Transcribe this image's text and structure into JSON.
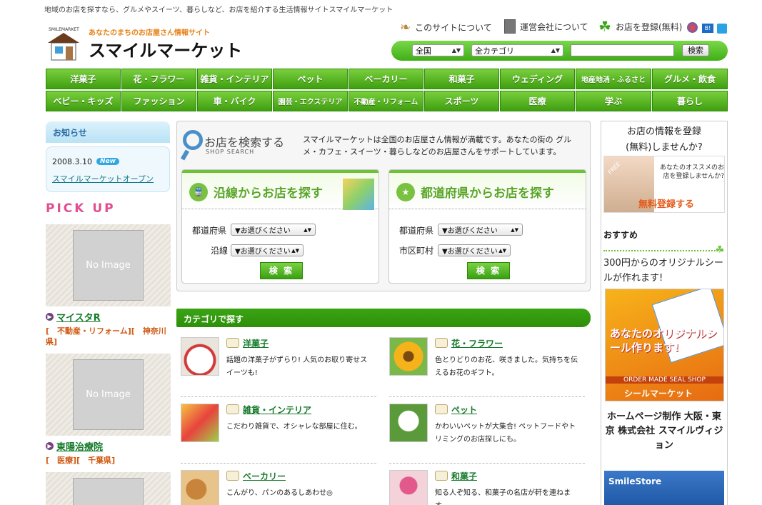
{
  "header": {
    "tagline": "地域のお店を探すなら、グルメやスイーツ、暮らしなど、お店を紹介する生活情報サイトスマイルマーケット",
    "logo_arc": "SMILEMARKET",
    "logo_sub": "あなたのまちのお店屋さん情報サイト",
    "logo_main": "スマイルマーケット",
    "links": [
      {
        "label": "このサイトについて",
        "icon": "bird-icon"
      },
      {
        "label": "運営会社について",
        "icon": "building-icon"
      },
      {
        "label": "お店を登録(無料)",
        "icon": "sprout-icon"
      }
    ],
    "search": {
      "area": "全国",
      "category": "全カテゴリ",
      "keyword": "",
      "button": "検索"
    }
  },
  "nav": {
    "row1": [
      "洋菓子",
      "花・フラワー",
      "雑貨・インテリア",
      "ペット",
      "ベーカリー",
      "和菓子",
      "ウェディング",
      "地産地消・ふるさと",
      "グルメ・飲食"
    ],
    "row2": [
      "ベビー・キッズ",
      "ファッション",
      "車・バイク",
      "園芸・エクステリア",
      "不動産・リフォーム",
      "スポーツ",
      "医療",
      "学ぶ",
      "暮らし"
    ]
  },
  "left": {
    "news_title": "お知らせ",
    "news": {
      "date": "2008.3.10",
      "badge": "New",
      "text": "スマイルマーケットオープン"
    },
    "pickup_label": "PICK UP",
    "no_image": "No Image",
    "picks": [
      {
        "name": "マイスタR",
        "cat": "[　不動産・リフォーム][　神奈川県]"
      },
      {
        "name": "東陽治療院",
        "cat": "[　医療][　千葉県]"
      }
    ]
  },
  "shop_search": {
    "title": "お店を検索する",
    "subtitle": "SHOP SEARCH",
    "desc": "スマイルマーケットは全国のお店屋さん情報が満載です。あなたの街の グルメ・カフェ・スイーツ・暮らしなどのお店屋さんをサポートしています。",
    "line_panel": {
      "title": "沿線からお店を探す",
      "pref_label": "都道府県",
      "pref_value": "▼お選びください",
      "line_label": "沿線",
      "line_value": "▼お選びください",
      "button": "検 索"
    },
    "pref_panel": {
      "title": "都道府県からお店を探す",
      "pref_label": "都道府県",
      "pref_value": "▼お選びください",
      "city_label": "市区町村",
      "city_value": "▼お選びください",
      "button": "検 索"
    }
  },
  "category": {
    "bar_title": "カテゴリで探す",
    "items": [
      {
        "title": "洋菓子",
        "desc": "話題の洋菓子がずらり! 人気のお取り寄せスイーツも!"
      },
      {
        "title": "花・フラワー",
        "desc": "色とりどりのお花、咲きました。気持ちを伝えるお花のギフト。"
      },
      {
        "title": "雑貨・インテリア",
        "desc": "こだわり雑貨で、オシャレな部屋に住む。"
      },
      {
        "title": "ペット",
        "desc": "かわいいペットが大集合! ペットフードやトリミングのお店探しにも。"
      },
      {
        "title": "ベーカリー",
        "desc": "こんがり、パンのあるしあわせ◎"
      },
      {
        "title": "和菓子",
        "desc": "知る人ぞ知る、和菓子の名店が軒を連ねます。"
      }
    ]
  },
  "right": {
    "register_text": "お店の情報を登録(無料)しませんか?",
    "free_label": "FREE",
    "free_text": "あなたのオススメのお店を登録しませんか?",
    "free_button": "無料登録する",
    "recommend_title": "おすすめ",
    "recommend_text": "300円からのオリジナルシールが作れます!",
    "seal_headline": "あなたのオリジナルシール作ります!",
    "seal_caption": "ORDER MADE SEAL SHOP",
    "seal_button": "シールマーケット",
    "hp_text": "ホームページ制作 大阪・東京 株式会社 スマイルヴィジョン",
    "smilestore": "SmileStore"
  }
}
